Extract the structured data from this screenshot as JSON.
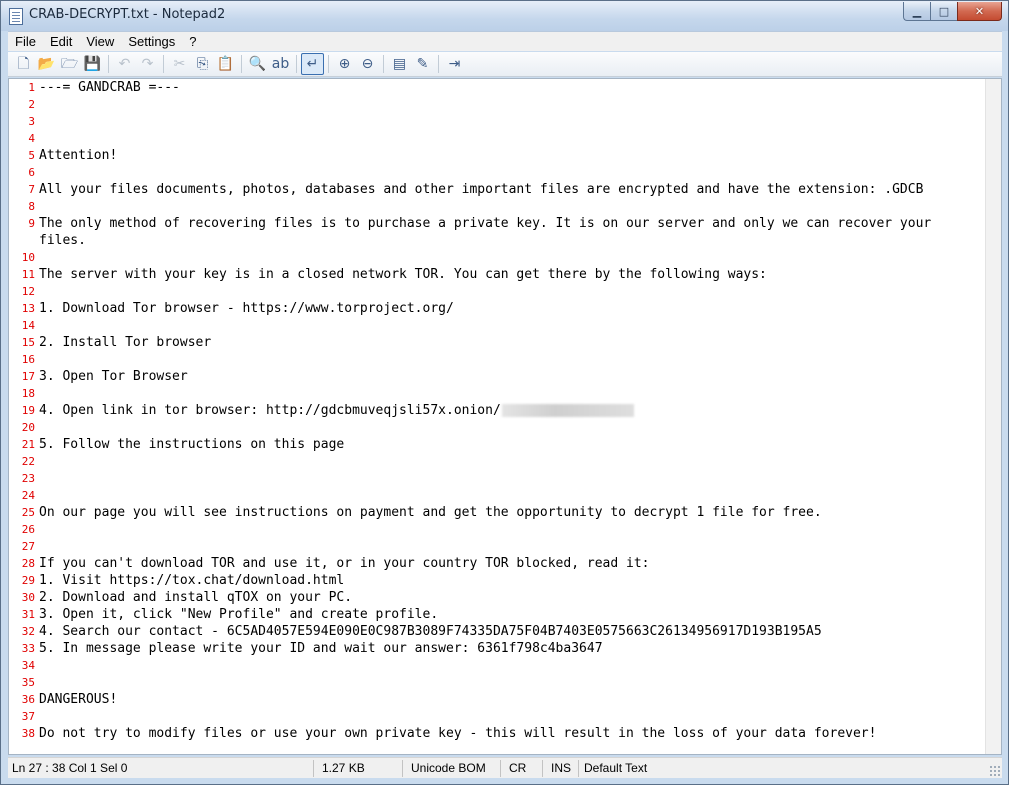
{
  "window": {
    "title": "CRAB-DECRYPT.txt - Notepad2",
    "controls": {
      "minimize": "▁",
      "maximize": "□",
      "close": "✕"
    }
  },
  "menu": [
    "File",
    "Edit",
    "View",
    "Settings",
    "?"
  ],
  "toolbar": {
    "buttons": [
      {
        "name": "new-file-icon",
        "glyph": "🗋",
        "enabled": true
      },
      {
        "name": "open-file-icon",
        "glyph": "📂",
        "enabled": true
      },
      {
        "name": "browse-icon",
        "glyph": "🗁",
        "enabled": true
      },
      {
        "name": "save-icon",
        "glyph": "💾",
        "enabled": true
      },
      {
        "sep": true
      },
      {
        "name": "undo-icon",
        "glyph": "↶",
        "enabled": false
      },
      {
        "name": "redo-icon",
        "glyph": "↷",
        "enabled": false
      },
      {
        "sep": true
      },
      {
        "name": "cut-icon",
        "glyph": "✂",
        "enabled": false
      },
      {
        "name": "copy-icon",
        "glyph": "⎘",
        "enabled": true
      },
      {
        "name": "paste-icon",
        "glyph": "📋",
        "enabled": false
      },
      {
        "sep": true
      },
      {
        "name": "find-icon",
        "glyph": "🔍",
        "enabled": true
      },
      {
        "name": "replace-icon",
        "glyph": "ab",
        "enabled": true
      },
      {
        "sep": true
      },
      {
        "name": "word-wrap-icon",
        "glyph": "↵",
        "enabled": true,
        "pressed": true
      },
      {
        "sep": true
      },
      {
        "name": "zoom-in-icon",
        "glyph": "⊕",
        "enabled": true
      },
      {
        "name": "zoom-out-icon",
        "glyph": "⊖",
        "enabled": true
      },
      {
        "sep": true
      },
      {
        "name": "scheme-icon",
        "glyph": "▤",
        "enabled": true
      },
      {
        "name": "scheme-config-icon",
        "glyph": "✎",
        "enabled": true
      },
      {
        "sep": true
      },
      {
        "name": "exit-icon",
        "glyph": "⇥",
        "enabled": true
      }
    ]
  },
  "editor": {
    "line_number_color": "#e00000",
    "lines": [
      {
        "n": "1",
        "text": "---= GANDCRAB =---"
      },
      {
        "n": "2",
        "text": ""
      },
      {
        "n": "3",
        "text": ""
      },
      {
        "n": "4",
        "text": ""
      },
      {
        "n": "5",
        "text": "Attention!"
      },
      {
        "n": "6",
        "text": ""
      },
      {
        "n": "7",
        "text": "All your files documents, photos, databases and other important files are encrypted and have the extension: .GDCB"
      },
      {
        "n": "8",
        "text": ""
      },
      {
        "n": "9",
        "text": "The only method of recovering files is to purchase a private key. It is on our server and only we can recover your files."
      },
      {
        "n": "10",
        "text": ""
      },
      {
        "n": "11",
        "text": "The server with your key is in a closed network TOR. You can get there by the following ways:"
      },
      {
        "n": "12",
        "text": ""
      },
      {
        "n": "13",
        "text": "1. Download Tor browser - https://www.torproject.org/"
      },
      {
        "n": "14",
        "text": ""
      },
      {
        "n": "15",
        "text": "2. Install Tor browser"
      },
      {
        "n": "16",
        "text": ""
      },
      {
        "n": "17",
        "text": "3. Open Tor Browser"
      },
      {
        "n": "18",
        "text": ""
      },
      {
        "n": "19",
        "text": "4. Open link in tor browser: http://gdcbmuveqjsli57x.onion/",
        "redacted": true
      },
      {
        "n": "20",
        "text": ""
      },
      {
        "n": "21",
        "text": "5. Follow the instructions on this page"
      },
      {
        "n": "22",
        "text": ""
      },
      {
        "n": "23",
        "text": ""
      },
      {
        "n": "24",
        "text": ""
      },
      {
        "n": "25",
        "text": "On our page you will see instructions on payment and get the opportunity to decrypt 1 file for free."
      },
      {
        "n": "26",
        "text": ""
      },
      {
        "n": "27",
        "text": ""
      },
      {
        "n": "28",
        "text": "If you can't download TOR and use it, or in your country TOR blocked, read it:"
      },
      {
        "n": "29",
        "text": "1. Visit https://tox.chat/download.html"
      },
      {
        "n": "30",
        "text": "2. Download and install qTOX on your PC."
      },
      {
        "n": "31",
        "text": "3. Open it, click \"New Profile\" and create profile."
      },
      {
        "n": "32",
        "text": "4. Search our contact - 6C5AD4057E594E090E0C987B3089F74335DA75F04B7403E0575663C26134956917D193B195A5"
      },
      {
        "n": "33",
        "text": "5. In message please write your ID and wait our answer: 6361f798c4ba3647"
      },
      {
        "n": "34",
        "text": ""
      },
      {
        "n": "35",
        "text": ""
      },
      {
        "n": "36",
        "text": "DANGEROUS!"
      },
      {
        "n": "37",
        "text": ""
      },
      {
        "n": "38",
        "text": "Do not try to modify files or use your own private key - this will result in the loss of your data forever!"
      }
    ]
  },
  "status": {
    "position": "Ln 27 : 38   Col 1   Sel 0",
    "size": "1.27 KB",
    "encoding": "Unicode BOM",
    "line_ending": "CR",
    "mode": "INS",
    "scheme": "Default Text"
  }
}
